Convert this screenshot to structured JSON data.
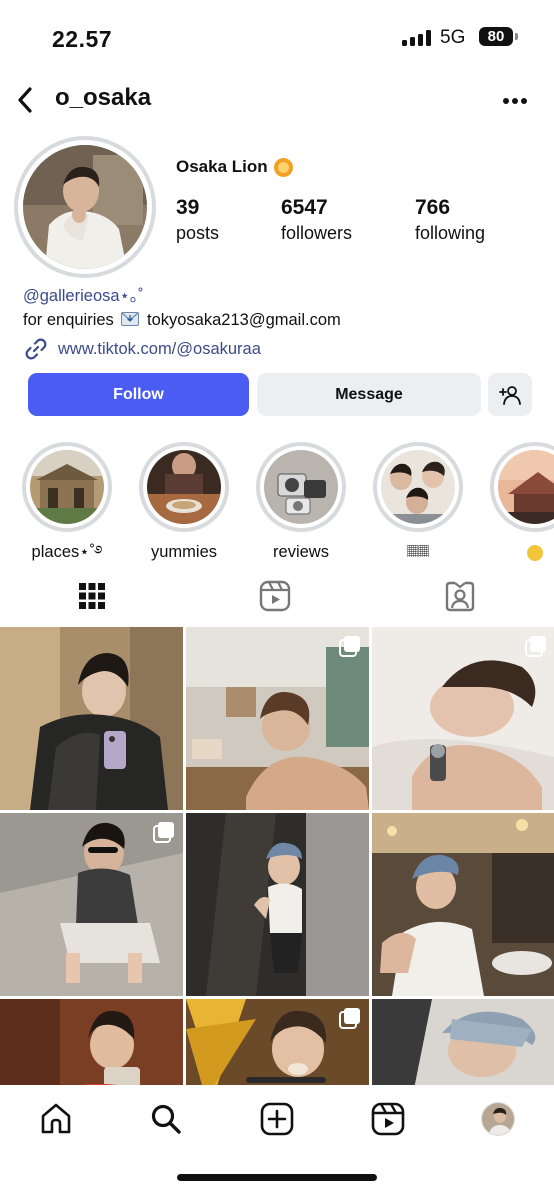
{
  "status_bar": {
    "time": "22.57",
    "network": "5G",
    "battery": "80"
  },
  "header": {
    "username": "o_osaka",
    "back_icon": "chevron-left-icon",
    "more_icon": "more-horizontal-icon"
  },
  "profile": {
    "display_name": "Osaka Lion",
    "emoji": "lion-face-icon",
    "stats": [
      {
        "value": "39",
        "label": "posts"
      },
      {
        "value": "6547",
        "label": "followers"
      },
      {
        "value": "766",
        "label": "following"
      }
    ],
    "bio": {
      "handle": "@gallerieosa⋆｡˚",
      "enquiries_prefix": "for enquiries",
      "email": "tokyosaka213@gmail.com",
      "link": "www.tiktok.com/@osakuraa"
    }
  },
  "actions": {
    "follow": "Follow",
    "message": "Message",
    "add_user_icon": "add-user-icon"
  },
  "highlights": [
    {
      "label": "places⋆˚࿔"
    },
    {
      "label": "yummies"
    },
    {
      "label": "reviews"
    },
    {
      "label": "𝄜𝄜"
    },
    {
      "label": ""
    }
  ],
  "tabs": [
    "grid-icon",
    "reels-icon",
    "tagged-icon"
  ],
  "bottom_nav": [
    "home-icon",
    "search-icon",
    "create-icon",
    "reels-icon",
    "profile-avatar"
  ],
  "colors": {
    "accent": "#4a5cf2",
    "link": "#3b4a8a",
    "button_grey": "#eceef1"
  }
}
